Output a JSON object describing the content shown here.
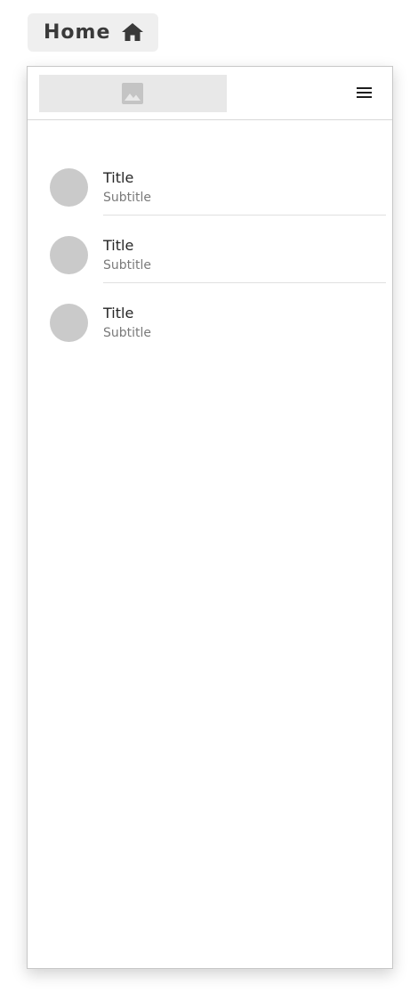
{
  "home_chip": {
    "label": "Home",
    "icon": "home-icon"
  },
  "app_bar": {
    "logo_icon": "image-icon",
    "menu_icon": "menu-icon"
  },
  "list": {
    "items": [
      {
        "title": "Title",
        "subtitle": "Subtitle"
      },
      {
        "title": "Title",
        "subtitle": "Subtitle"
      },
      {
        "title": "Title",
        "subtitle": "Subtitle"
      }
    ]
  },
  "colors": {
    "chip_background": "#efefef",
    "avatar_placeholder": "#cacaca",
    "image_placeholder": "#e8e8e8",
    "divider": "#e0e0e0"
  }
}
